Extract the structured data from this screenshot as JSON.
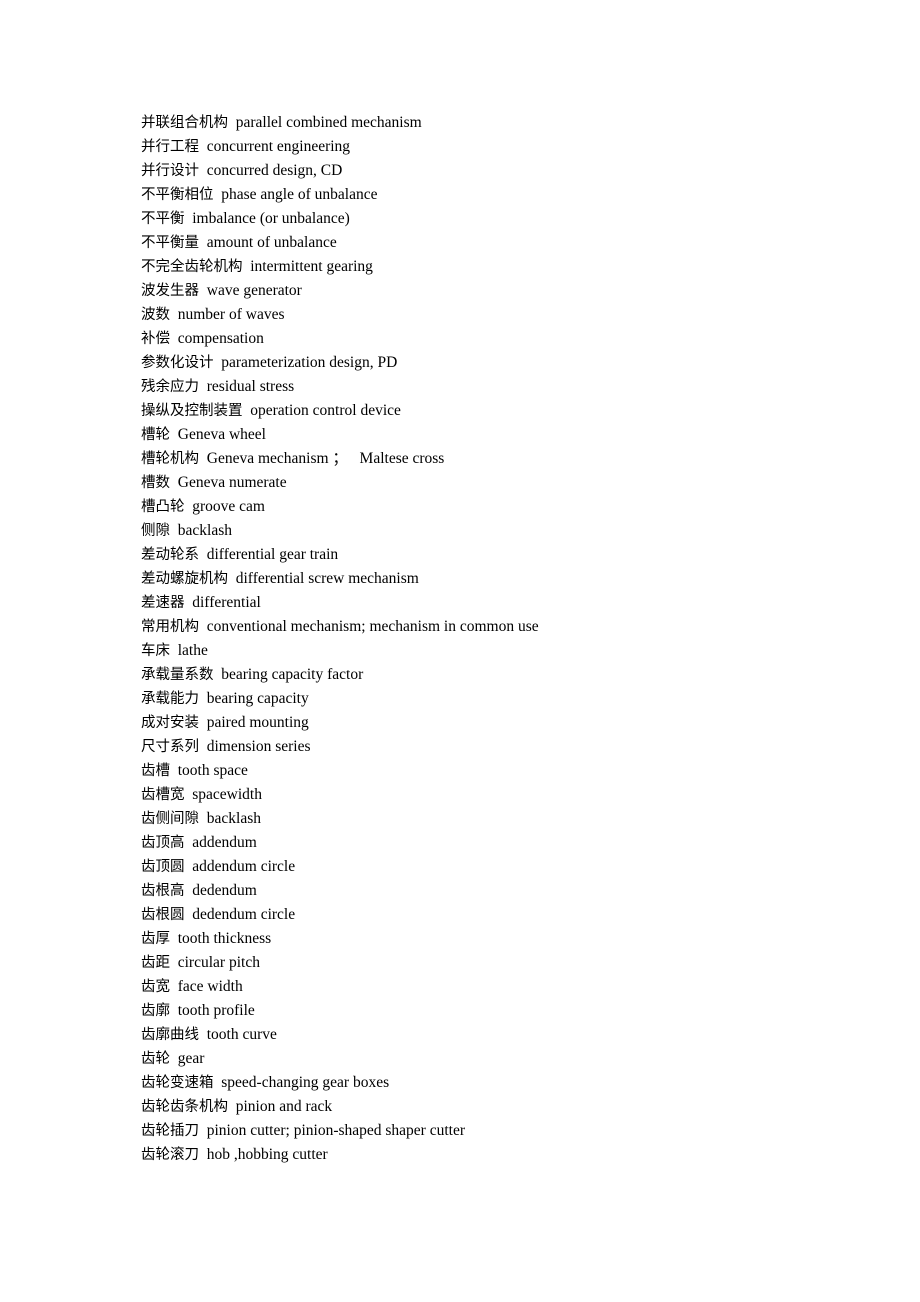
{
  "page": {
    "background_color": "#ffffff",
    "text_color": "#000000",
    "document_type": "bilingual-glossary",
    "separator": "  "
  },
  "glossary": {
    "entries": [
      {
        "term": "并联组合机构",
        "gloss": "parallel combined mechanism"
      },
      {
        "term": "并行工程",
        "gloss": "concurrent engineering"
      },
      {
        "term": "并行设计",
        "gloss": "concurred design, CD"
      },
      {
        "term": "不平衡相位",
        "gloss": "phase angle of unbalance"
      },
      {
        "term": "不平衡",
        "gloss": "imbalance (or unbalance)"
      },
      {
        "term": "不平衡量",
        "gloss": "amount of unbalance"
      },
      {
        "term": "不完全齿轮机构",
        "gloss": "intermittent gearing"
      },
      {
        "term": "波发生器",
        "gloss": "wave generator"
      },
      {
        "term": "波数",
        "gloss": "number of waves"
      },
      {
        "term": "补偿",
        "gloss": "compensation"
      },
      {
        "term": "参数化设计",
        "gloss": "parameterization design, PD"
      },
      {
        "term": "残余应力",
        "gloss": "residual stress"
      },
      {
        "term": "操纵及控制装置",
        "gloss": "operation control device"
      },
      {
        "term": "槽轮",
        "gloss": "Geneva wheel"
      },
      {
        "term": "槽轮机构",
        "gloss": "Geneva mechanism ；   Maltese cross"
      },
      {
        "term": "槽数",
        "gloss": "Geneva numerate"
      },
      {
        "term": "槽凸轮",
        "gloss": "groove cam"
      },
      {
        "term": "侧隙",
        "gloss": "backlash"
      },
      {
        "term": "差动轮系",
        "gloss": "differential gear train"
      },
      {
        "term": "差动螺旋机构",
        "gloss": "differential screw mechanism"
      },
      {
        "term": "差速器",
        "gloss": "differential"
      },
      {
        "term": "常用机构",
        "gloss": "conventional mechanism; mechanism in common use"
      },
      {
        "term": "车床",
        "gloss": "lathe"
      },
      {
        "term": "承载量系数",
        "gloss": "bearing capacity factor"
      },
      {
        "term": "承载能力",
        "gloss": "bearing capacity"
      },
      {
        "term": "成对安装",
        "gloss": "paired mounting"
      },
      {
        "term": "尺寸系列",
        "gloss": "dimension series"
      },
      {
        "term": "齿槽",
        "gloss": "tooth space"
      },
      {
        "term": "齿槽宽",
        "gloss": "spacewidth"
      },
      {
        "term": "齿侧间隙",
        "gloss": "backlash"
      },
      {
        "term": "齿顶高",
        "gloss": "addendum"
      },
      {
        "term": "齿顶圆",
        "gloss": "addendum circle"
      },
      {
        "term": "齿根高",
        "gloss": "dedendum"
      },
      {
        "term": "齿根圆",
        "gloss": "dedendum circle"
      },
      {
        "term": "齿厚",
        "gloss": "tooth thickness"
      },
      {
        "term": "齿距",
        "gloss": "circular pitch"
      },
      {
        "term": "齿宽",
        "gloss": "face width"
      },
      {
        "term": "齿廓",
        "gloss": "tooth profile"
      },
      {
        "term": "齿廓曲线",
        "gloss": "tooth curve"
      },
      {
        "term": "齿轮",
        "gloss": "gear"
      },
      {
        "term": "齿轮变速箱",
        "gloss": "speed-changing gear boxes"
      },
      {
        "term": "齿轮齿条机构",
        "gloss": "pinion and rack"
      },
      {
        "term": "齿轮插刀",
        "gloss": "pinion cutter; pinion-shaped shaper cutter"
      },
      {
        "term": "齿轮滚刀",
        "gloss": "hob ,hobbing cutter"
      }
    ]
  }
}
